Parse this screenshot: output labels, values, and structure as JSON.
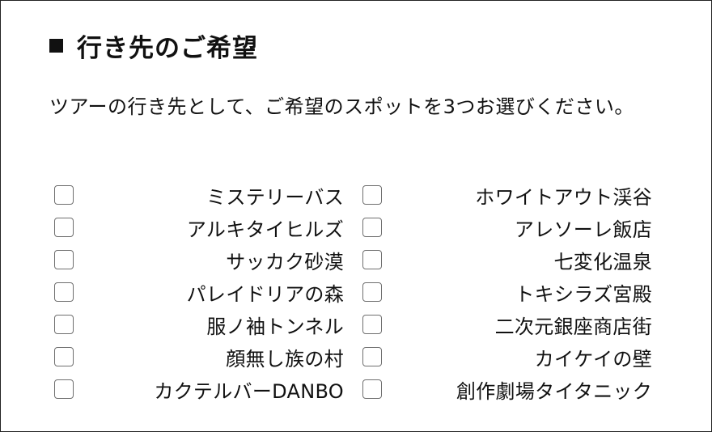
{
  "section": {
    "title": "行き先のご希望",
    "description": "ツアーの行き先として、ご希望のスポットを3つお選びください。"
  },
  "options": {
    "left": [
      {
        "label": "ミステリーバス",
        "checked": false
      },
      {
        "label": "アルキタイヒルズ",
        "checked": false
      },
      {
        "label": "サッカク砂漠",
        "checked": false
      },
      {
        "label": "パレイドリアの森",
        "checked": false
      },
      {
        "label": "服ノ袖トンネル",
        "checked": false
      },
      {
        "label": "顔無し族の村",
        "checked": false
      },
      {
        "label": "カクテルバーDANBO",
        "checked": false
      }
    ],
    "right": [
      {
        "label": "ホワイトアウト渓谷",
        "checked": false
      },
      {
        "label": "アレソーレ飯店",
        "checked": false
      },
      {
        "label": "七変化温泉",
        "checked": false
      },
      {
        "label": "トキシラズ宮殿",
        "checked": false
      },
      {
        "label": "二次元銀座商店街",
        "checked": false
      },
      {
        "label": "カイケイの壁",
        "checked": false
      },
      {
        "label": "創作劇場タイタニック",
        "checked": false
      }
    ]
  }
}
